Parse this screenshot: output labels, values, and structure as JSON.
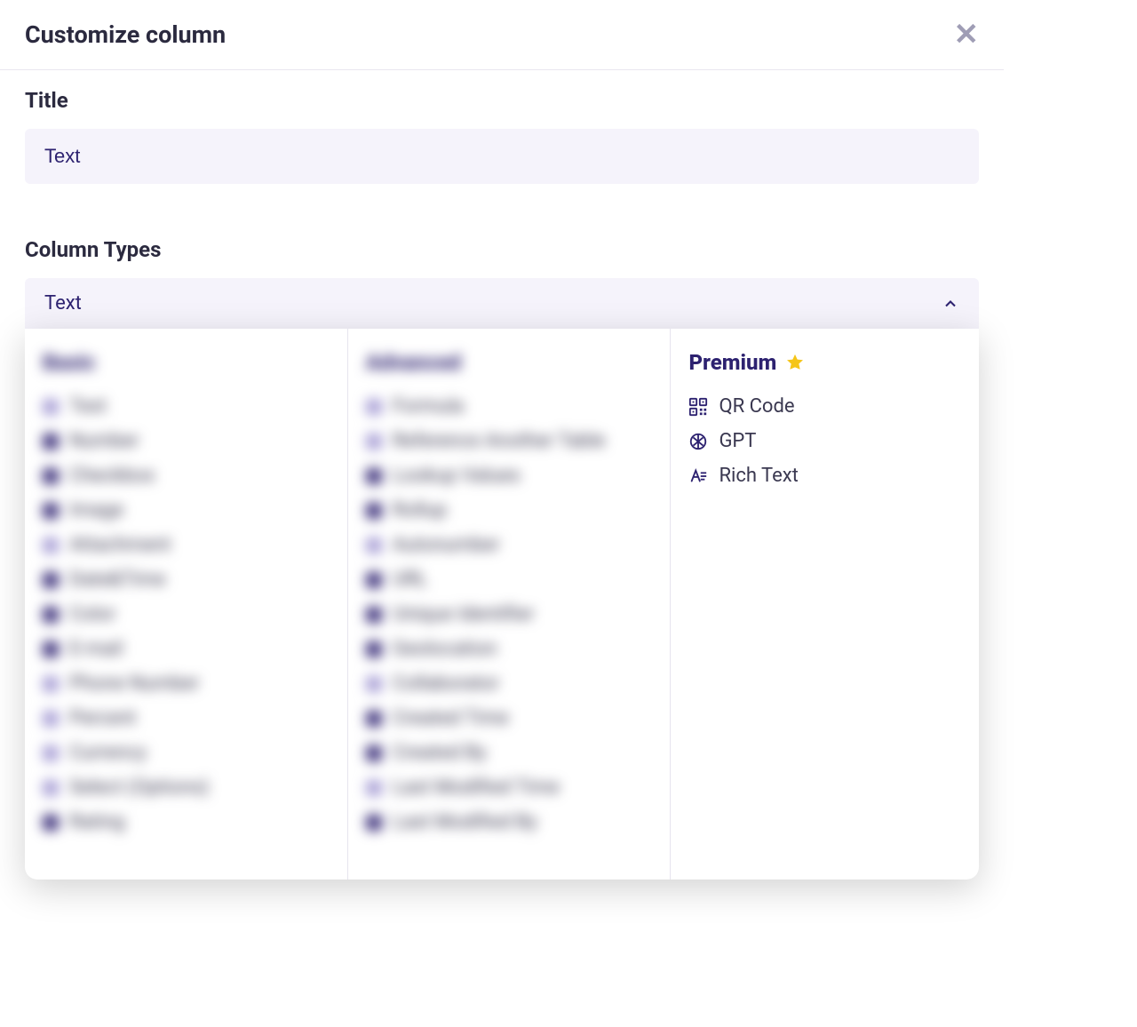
{
  "header": {
    "title": "Customize column"
  },
  "titleField": {
    "label": "Title",
    "value": "Text"
  },
  "columnTypes": {
    "label": "Column Types",
    "selected": "Text"
  },
  "groups": {
    "basic": {
      "heading": "Basic",
      "items": [
        "Text",
        "Number",
        "Checkbox",
        "Image",
        "Attachment",
        "Date&Time",
        "Color",
        "E-mail",
        "Phone Number",
        "Percent",
        "Currency",
        "Select (Options)",
        "Rating"
      ]
    },
    "advanced": {
      "heading": "Advanced",
      "items": [
        "Formula",
        "Reference Another Table",
        "Lookup Values",
        "Rollup",
        "Autonumber",
        "URL",
        "Unique Identifier",
        "Geolocation",
        "Collaborator",
        "Created Time",
        "Created By",
        "Last Modified Time",
        "Last Modified By"
      ]
    },
    "premium": {
      "heading": "Premium",
      "items": [
        {
          "label": "QR Code",
          "icon": "qrcode-icon"
        },
        {
          "label": "GPT",
          "icon": "gpt-icon"
        },
        {
          "label": "Rich Text",
          "icon": "richtext-icon"
        }
      ]
    }
  }
}
